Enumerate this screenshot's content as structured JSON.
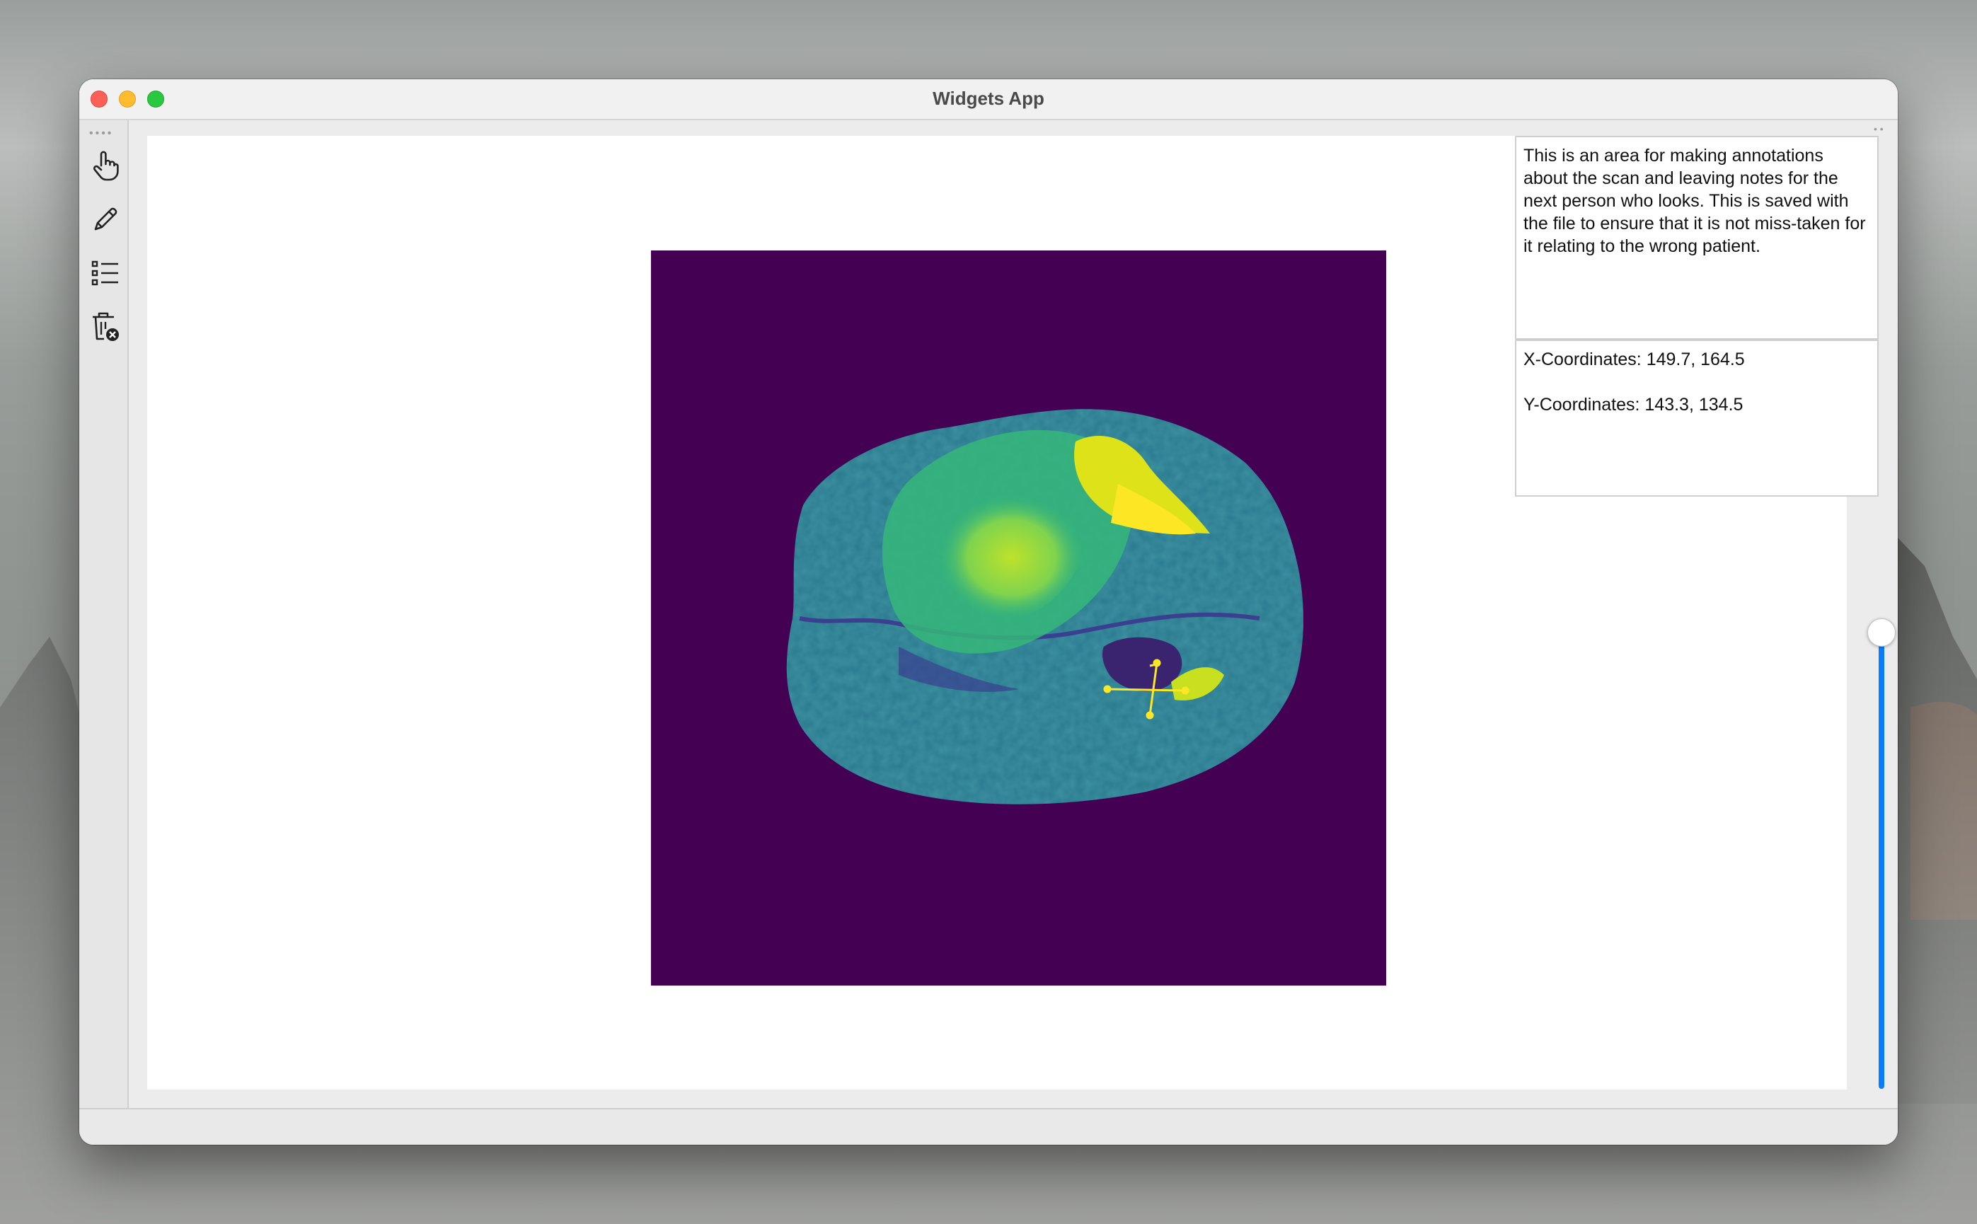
{
  "window": {
    "title": "Widgets App"
  },
  "toolbar": {
    "tools": [
      {
        "name": "pointer-tool",
        "icon": "hand-pointer-icon"
      },
      {
        "name": "pen-tool",
        "icon": "pencil-icon"
      },
      {
        "name": "list-tool",
        "icon": "list-icon"
      },
      {
        "name": "clear-tool",
        "icon": "trash-clear-icon"
      }
    ]
  },
  "notes": {
    "text": "This is an area for making annotations about the scan and leaving notes for the next person who looks. This is saved with the file to ensure that it is not miss-taken for it relating to the wrong patient."
  },
  "coordinates": {
    "x_text": "X-Coordinates: 149.7, 164.5",
    "y_text": "Y-Coordinates: 143.3, 134.5"
  },
  "slider": {
    "level": 0.5
  },
  "colors": {
    "scan_background": "#440154",
    "annotation": "#fde725",
    "accent": "#0a7cff"
  }
}
